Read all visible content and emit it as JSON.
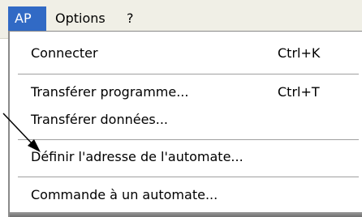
{
  "menubar": {
    "items": [
      {
        "label": "AP"
      },
      {
        "label": "Options"
      },
      {
        "label": "?"
      }
    ]
  },
  "menu": {
    "items": [
      {
        "label": "Connecter",
        "shortcut": "Ctrl+K"
      },
      {
        "label": "Transférer programme...",
        "shortcut": "Ctrl+T"
      },
      {
        "label": "Transférer données..."
      },
      {
        "label": "Définir l'adresse de l'automate..."
      },
      {
        "label": "Commande à un automate..."
      }
    ]
  },
  "colors": {
    "highlight": "#316ac5",
    "menubar_bg": "#f0efe6"
  }
}
